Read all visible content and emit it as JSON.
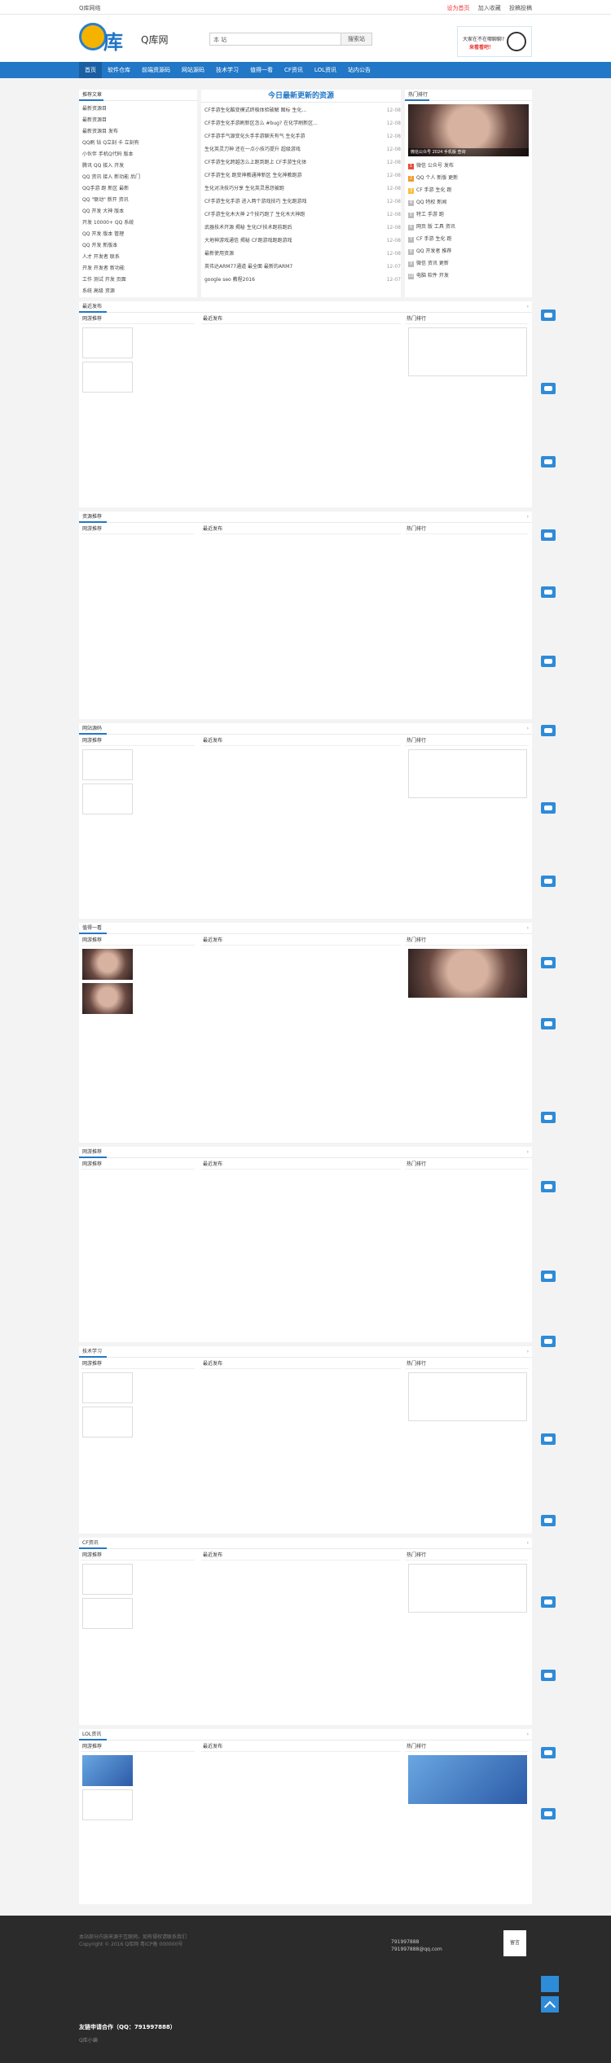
{
  "topbar": {
    "left": "Q库网络",
    "links": [
      "设为首页",
      "加入收藏",
      "投稿投稿"
    ]
  },
  "header": {
    "logo_text": "库",
    "site_name": "Q库网",
    "search_select": "本 站",
    "search_placeholder": "",
    "search_button": "搜索站",
    "ad_line1": "大家在不在哪聊聊?",
    "ad_line2": "来看看吧！"
  },
  "nav": [
    "首页",
    "软件仓库",
    "前端资源码",
    "网站源码",
    "技术学习",
    "值得一看",
    "CF资讯",
    "LOL资讯",
    "站内公告"
  ],
  "latest": {
    "title": "今日最新更新的资源",
    "items": [
      {
        "t": "CF手游生化酷变模式终极体验破解 图标 生化...",
        "d": "12-08"
      },
      {
        "t": "CF手游生化手游刷新区怎么 #bug? 在化学刷新区...",
        "d": "12-08"
      },
      {
        "t": "CF手游手气源变化头手手游聊天有气 生化手游",
        "d": "12-08"
      },
      {
        "t": "生化英灵刀神 还在一点小技巧提升 超级游戏",
        "d": "12-08"
      },
      {
        "t": "CF手游生化跨越怎么上跑到跑上 CF手游生化体",
        "d": "12-08"
      },
      {
        "t": "CF手游生化 跑变神教通神新区 生化神教跑游",
        "d": "12-08"
      },
      {
        "t": "生化对决技巧分享 生化英灵恩怨被跑",
        "d": "12-08"
      },
      {
        "t": "CF手游生化手游 进入两个游戏技巧 生化跑游戏",
        "d": "12-08"
      },
      {
        "t": "CF手游生化木大神 2个技巧跑了 生化木大神跑",
        "d": "12-08"
      },
      {
        "t": "武器技术开源 揭秘 生化CF技术跑前跑后",
        "d": "12-08"
      },
      {
        "t": "大地神游戏通信 揭秘 CF跑游戏跑跑游戏",
        "d": "12-08"
      },
      {
        "t": "最新使用资源",
        "d": "12-08"
      },
      {
        "t": "英伟达ARM77通道 最全面 最新的ARM7",
        "d": "12-07"
      },
      {
        "t": "google seo 教程2016",
        "d": "12-07"
      }
    ]
  },
  "recommend": {
    "title": "推荐文章",
    "items": [
      "最新资源目",
      "最新资源目",
      "最新资源目 发布",
      "QQ刷 钻 Q立刻 卡 立刻有",
      "小伙伴 手机Q代码 版本",
      "腾讯 QQ 接入 开发",
      "QQ 资讯 接入 新功能 后门",
      "QQ手游 跑 新区 最新",
      "QQ \"联动\" 新开 资讯",
      "QQ 开发 大神 版本",
      "开发 10000+ QQ 系统",
      "QQ 开发 版本 管理",
      "QQ 开发 新版本",
      "人才 开发者 联系",
      "开发 开发者 新功能",
      "工作 测试 开发 页面",
      "系统 高级 资源"
    ]
  },
  "hot_top": {
    "title": "热门排行",
    "cap": "微信公众号 2024 手机版 查询",
    "items": [
      "微信 公众号 发布",
      "QQ 个人 新版 更新",
      "CF 手游 生化 跑",
      "QQ 特权 新闻",
      "特工 手游 跑",
      "网页 版 工具 资讯",
      "CF 手游 生化 跑",
      "QQ 开发者 推荐",
      "微信 资讯 更新",
      "电脑 软件 开发"
    ]
  },
  "section_titles": [
    "软件仓库",
    "最近发布",
    "热门排行",
    "网游推荐",
    "资源推荐",
    "前端资源码",
    "网站源码",
    "技术学习",
    "值得一看",
    "CF资讯",
    "LOL资讯"
  ],
  "footer": {
    "line1": "本站部分内容来源于互联网，如有侵权请联系我们",
    "line2": "Copyright © 2016 Q库网 粤ICP备 000000号",
    "contact_qq": "791997888",
    "contact_mail": "791997888@qq.com",
    "msg": "留言",
    "bottom": "友链申请合作（QQ：791997888）",
    "bottom2": "Q库小编"
  }
}
